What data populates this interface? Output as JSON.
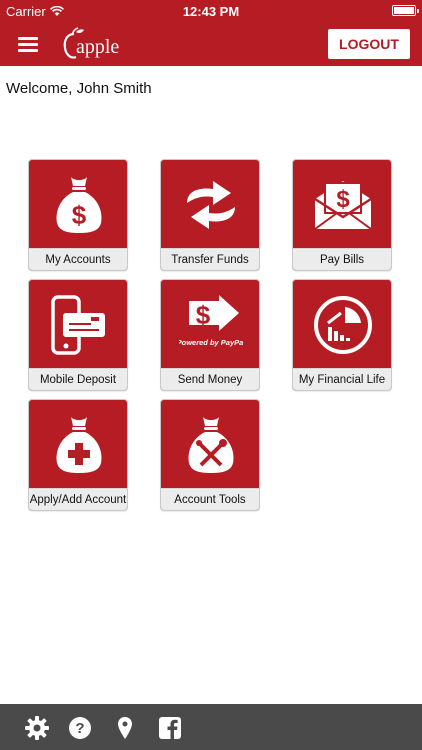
{
  "status_bar": {
    "carrier": "Carrier",
    "time": "12:43 PM"
  },
  "header": {
    "logo_text": "apple",
    "logout_label": "LOGOUT",
    "brand_color": "#b51c24"
  },
  "welcome": "Welcome, John Smith",
  "tiles": [
    {
      "label": "My Accounts",
      "icon": "money-bag-dollar-icon"
    },
    {
      "label": "Transfer Funds",
      "icon": "transfer-arrows-icon"
    },
    {
      "label": "Pay Bills",
      "icon": "envelope-dollar-icon"
    },
    {
      "label": "Mobile Deposit",
      "icon": "phone-check-icon"
    },
    {
      "label": "Send Money",
      "icon": "paypal-send-icon",
      "icon_text": "Powered by PayPal"
    },
    {
      "label": "My Financial Life",
      "icon": "pie-chart-icon"
    },
    {
      "label": "Apply/Add Account",
      "icon": "money-bag-plus-icon"
    },
    {
      "label": "Account Tools",
      "icon": "money-bag-tools-icon"
    }
  ],
  "bottom_bar": {
    "icons": [
      "gear-icon",
      "help-icon",
      "location-pin-icon",
      "facebook-icon"
    ]
  }
}
